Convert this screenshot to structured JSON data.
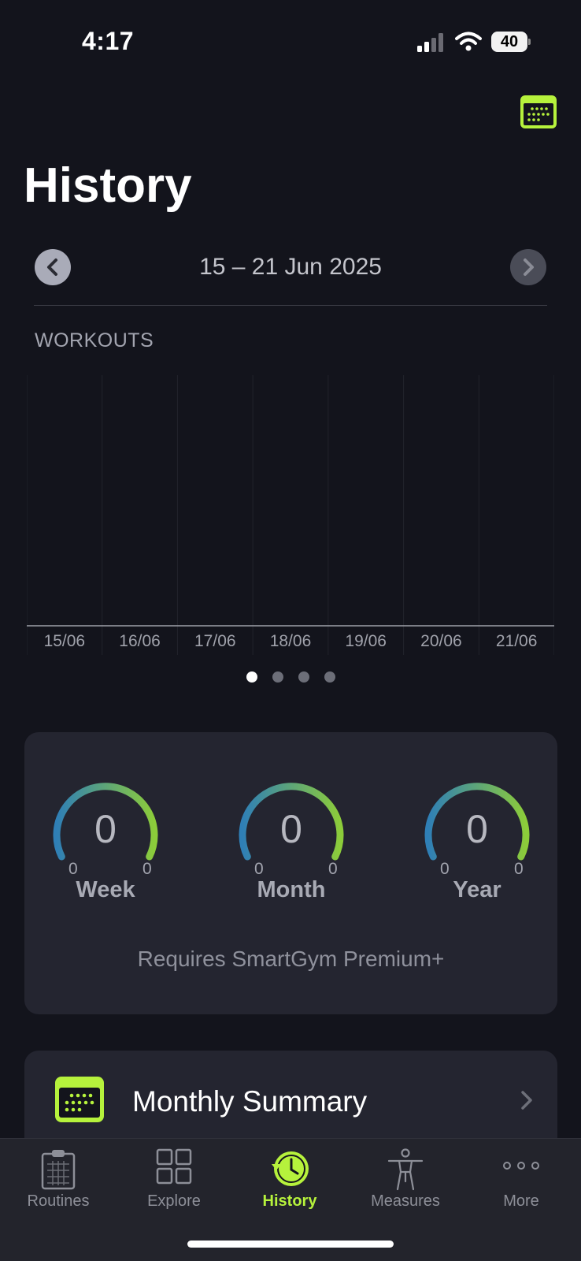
{
  "status_bar": {
    "time": "4:17",
    "battery": "40"
  },
  "header": {
    "title": "History"
  },
  "week_nav": {
    "date_range": "15 – 21 Jun 2025"
  },
  "workouts_section": {
    "label": "WORKOUTS"
  },
  "chart_data": {
    "type": "bar",
    "categories": [
      "15/06",
      "16/06",
      "17/06",
      "18/06",
      "19/06",
      "20/06",
      "21/06"
    ],
    "values": [
      0,
      0,
      0,
      0,
      0,
      0,
      0
    ],
    "title": "WORKOUTS",
    "xlabel": "",
    "ylabel": ""
  },
  "pager": {
    "pages": 4,
    "active": 0
  },
  "stats": {
    "gauges": [
      {
        "label": "Week",
        "value": "0",
        "min": "0",
        "max": "0"
      },
      {
        "label": "Month",
        "value": "0",
        "min": "0",
        "max": "0"
      },
      {
        "label": "Year",
        "value": "0",
        "min": "0",
        "max": "0"
      }
    ],
    "note": "Requires SmartGym Premium+"
  },
  "summary": {
    "label": "Monthly Summary"
  },
  "tab_bar": {
    "tabs": [
      {
        "label": "Routines",
        "icon": "clipboard-icon"
      },
      {
        "label": "Explore",
        "icon": "grid-icon"
      },
      {
        "label": "History",
        "icon": "history-clock-icon"
      },
      {
        "label": "Measures",
        "icon": "body-figure-icon"
      },
      {
        "label": "More",
        "icon": "more-dots-icon"
      }
    ],
    "active": 2
  },
  "colors": {
    "accent": "#b6f23c",
    "background": "#13141c",
    "card": "#242530",
    "gauge_start": "#2f7fb6",
    "gauge_end": "#8ccc3a"
  }
}
